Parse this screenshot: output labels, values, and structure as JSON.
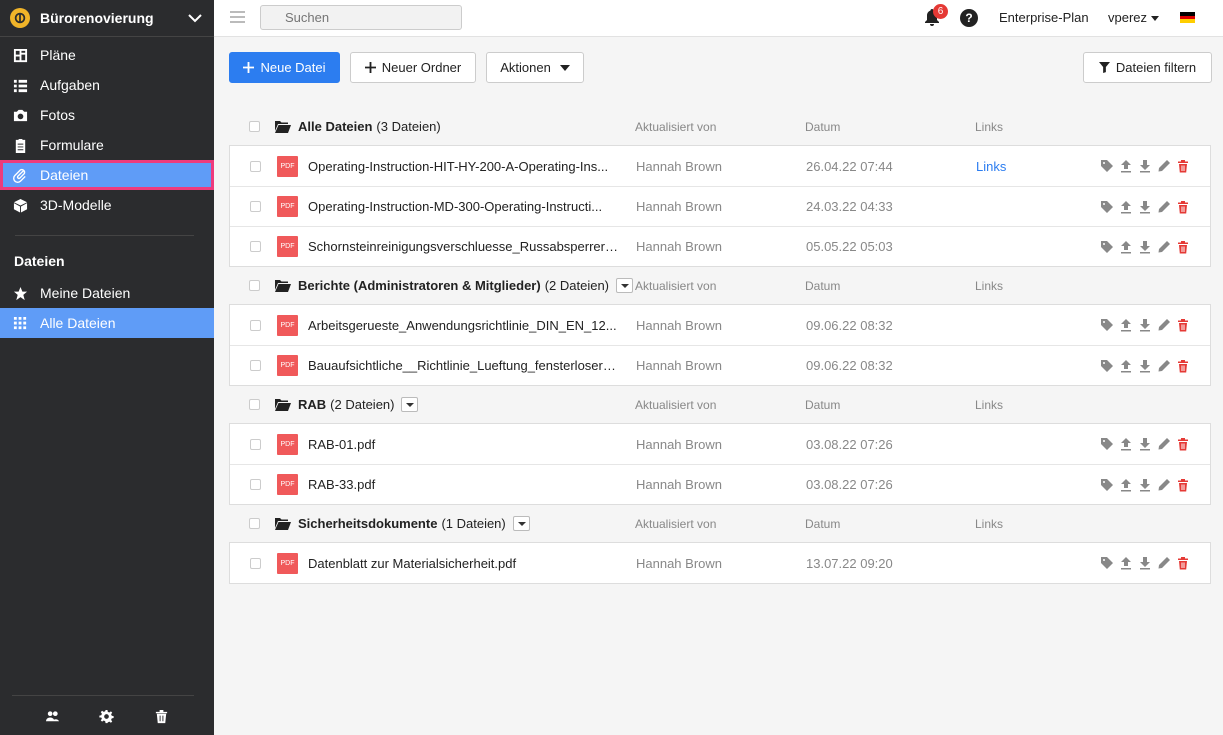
{
  "project": {
    "name": "Bürorenovierung"
  },
  "nav": {
    "items": [
      {
        "label": "Pläne",
        "icon": "plans-icon"
      },
      {
        "label": "Aufgaben",
        "icon": "list-icon"
      },
      {
        "label": "Fotos",
        "icon": "camera-icon"
      },
      {
        "label": "Formulare",
        "icon": "clipboard-icon"
      },
      {
        "label": "Dateien",
        "icon": "paperclip-icon"
      },
      {
        "label": "3D-Modelle",
        "icon": "cube-icon"
      }
    ],
    "section_title": "Dateien",
    "sub_items": [
      {
        "label": "Meine Dateien",
        "icon": "star-icon"
      },
      {
        "label": "Alle Dateien",
        "icon": "grid-icon"
      }
    ]
  },
  "topbar": {
    "search_placeholder": "Suchen",
    "notification_count": "6",
    "help": "?",
    "plan": "Enterprise-Plan",
    "user": "vperez"
  },
  "toolbar": {
    "new_file": "Neue Datei",
    "new_folder": "Neuer Ordner",
    "actions": "Aktionen",
    "filter": "Dateien filtern"
  },
  "columns": {
    "updated_by": "Aktualisiert von",
    "date": "Datum",
    "links": "Links"
  },
  "colors": {
    "accent": "#2c7df0",
    "active_nav": "#5f9cf7",
    "highlight": "#ee3b7d",
    "pdf": "#f0595a",
    "delete": "#e53935"
  },
  "groups": [
    {
      "name": "Alle Dateien",
      "count": "(3 Dateien)",
      "files": [
        {
          "name": "Operating-Instruction-HIT-HY-200-A-Operating-Ins...",
          "updated_by": "Hannah Brown",
          "date": "26.04.22 07:44",
          "link": "Links"
        },
        {
          "name": "Operating-Instruction-MD-300-Operating-Instructi...",
          "updated_by": "Hannah Brown",
          "date": "24.03.22 04:33",
          "link": ""
        },
        {
          "name": "Schornsteinreinigungsverschluesse_Russabsperrer_...",
          "updated_by": "Hannah Brown",
          "date": "05.05.22 05:03",
          "link": ""
        }
      ]
    },
    {
      "name": "Berichte (Administratoren & Mitglieder)",
      "count": "(2 Dateien)",
      "files": [
        {
          "name": "Arbeitsgerueste_Anwendungsrichtlinie_DIN_EN_12...",
          "updated_by": "Hannah Brown",
          "date": "09.06.22 08:32",
          "link": ""
        },
        {
          "name": "Bauaufsichtliche__Richtlinie_Lueftung_fensterloser_...",
          "updated_by": "Hannah Brown",
          "date": "09.06.22 08:32",
          "link": ""
        }
      ]
    },
    {
      "name": "RAB",
      "count": "(2 Dateien)",
      "files": [
        {
          "name": "RAB-01.pdf",
          "updated_by": "Hannah Brown",
          "date": "03.08.22 07:26",
          "link": ""
        },
        {
          "name": "RAB-33.pdf",
          "updated_by": "Hannah Brown",
          "date": "03.08.22 07:26",
          "link": ""
        }
      ]
    },
    {
      "name": "Sicherheitsdokumente",
      "count": "(1 Dateien)",
      "files": [
        {
          "name": "Datenblatt zur Materialsicherheit.pdf",
          "updated_by": "Hannah Brown",
          "date": "13.07.22 09:20",
          "link": ""
        }
      ]
    }
  ],
  "pdf_label": "PDF"
}
